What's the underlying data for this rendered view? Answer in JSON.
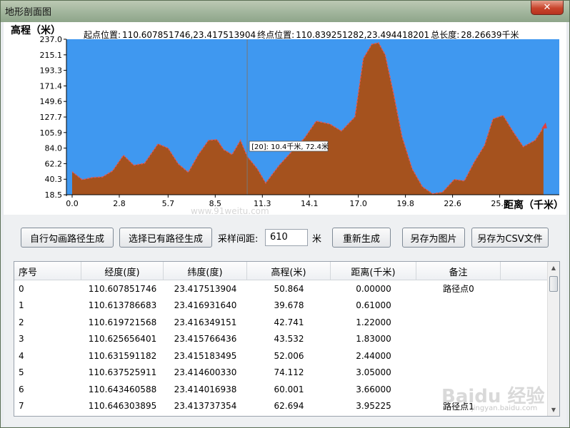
{
  "window": {
    "title": "地形剖面图",
    "close_glyph": "✕"
  },
  "profile_header": {
    "start_label": "起点位置:",
    "start_value": "110.607851746,23.417513904",
    "end_label": "终点位置:",
    "end_value": "110.839251282,23.494418201",
    "length_label": "总长度:",
    "length_value": "28.26639千米"
  },
  "chart_data": {
    "type": "area",
    "ylabel": "高程（米）",
    "xlabel": "距离（千米）",
    "y_ticks": [
      "237.0",
      "215.1",
      "193.3",
      "171.4",
      "149.6",
      "127.7",
      "105.9",
      "84.0",
      "62.2",
      "40.3",
      "18.5"
    ],
    "x_ticks": [
      "0.0",
      "2.8",
      "5.7",
      "8.5",
      "11.3",
      "14.1",
      "17.0",
      "19.8",
      "22.6",
      "25.4"
    ],
    "ylim": [
      18.5,
      237.0
    ],
    "xlim": [
      0.0,
      28.0
    ],
    "x": [
      0.0,
      0.6,
      1.2,
      1.8,
      2.4,
      3.05,
      3.66,
      4.3,
      5.1,
      5.7,
      6.3,
      6.9,
      7.5,
      8.1,
      8.6,
      9.0,
      9.5,
      10.0,
      10.4,
      11.0,
      11.5,
      12.3,
      13.0,
      13.8,
      14.5,
      15.3,
      16.0,
      16.8,
      17.3,
      17.8,
      18.2,
      18.6,
      19.1,
      19.6,
      20.2,
      20.8,
      21.4,
      22.0,
      22.7,
      23.3,
      23.9,
      24.5,
      25.0,
      25.6,
      26.2,
      26.8,
      27.5,
      28.0
    ],
    "y": [
      50.864,
      39.678,
      42.741,
      43.532,
      52.006,
      74.112,
      60.001,
      62.694,
      90.0,
      84.0,
      62.0,
      50.0,
      75.0,
      95.0,
      96.0,
      82.0,
      75.0,
      95.0,
      72.4,
      55.0,
      35.0,
      60.0,
      78.0,
      98.0,
      122.0,
      118.0,
      108.0,
      128.0,
      210.0,
      230.0,
      232.0,
      215.0,
      160.0,
      100.0,
      55.0,
      30.0,
      20.0,
      22.0,
      40.0,
      38.0,
      65.0,
      88.0,
      125.0,
      130.0,
      107.0,
      86.0,
      95.0,
      113.0
    ],
    "tooltip": "[20]: 10.4千米, 72.4米",
    "cursor_x": 10.4,
    "colors": {
      "plot_bg": "#3f98f0",
      "area_fill": "#a5521e",
      "line": "#e05a5a"
    }
  },
  "controls": {
    "btn_draw": "自行勾画路径生成",
    "btn_select": "选择已有路径生成",
    "interval_label": "采样间距:",
    "interval_value": "610",
    "interval_unit": "米",
    "btn_regen": "重新生成",
    "btn_save_img": "另存为图片",
    "btn_save_csv": "另存为CSV文件"
  },
  "table": {
    "headers": [
      "序号",
      "经度(度)",
      "纬度(度)",
      "高程(米)",
      "距离(千米)",
      "备注"
    ],
    "rows": [
      [
        "0",
        "110.607851746",
        "23.417513904",
        "50.864",
        "0.00000",
        "路径点0"
      ],
      [
        "1",
        "110.613786683",
        "23.416931640",
        "39.678",
        "0.61000",
        ""
      ],
      [
        "2",
        "110.619721568",
        "23.416349151",
        "42.741",
        "1.22000",
        ""
      ],
      [
        "3",
        "110.625656401",
        "23.415766436",
        "43.532",
        "1.83000",
        ""
      ],
      [
        "4",
        "110.631591182",
        "23.415183495",
        "52.006",
        "2.44000",
        ""
      ],
      [
        "5",
        "110.637525911",
        "23.414600330",
        "74.112",
        "3.05000",
        ""
      ],
      [
        "6",
        "110.643460588",
        "23.414016938",
        "60.001",
        "3.66000",
        ""
      ],
      [
        "7",
        "110.646303895",
        "23.413737354",
        "62.694",
        "3.95225",
        "路径点1"
      ]
    ]
  },
  "watermarks": {
    "site": "www.91weitu.com",
    "baidu": "Baidu 经验",
    "baidu_sub": "jingyan.baidu.com"
  }
}
